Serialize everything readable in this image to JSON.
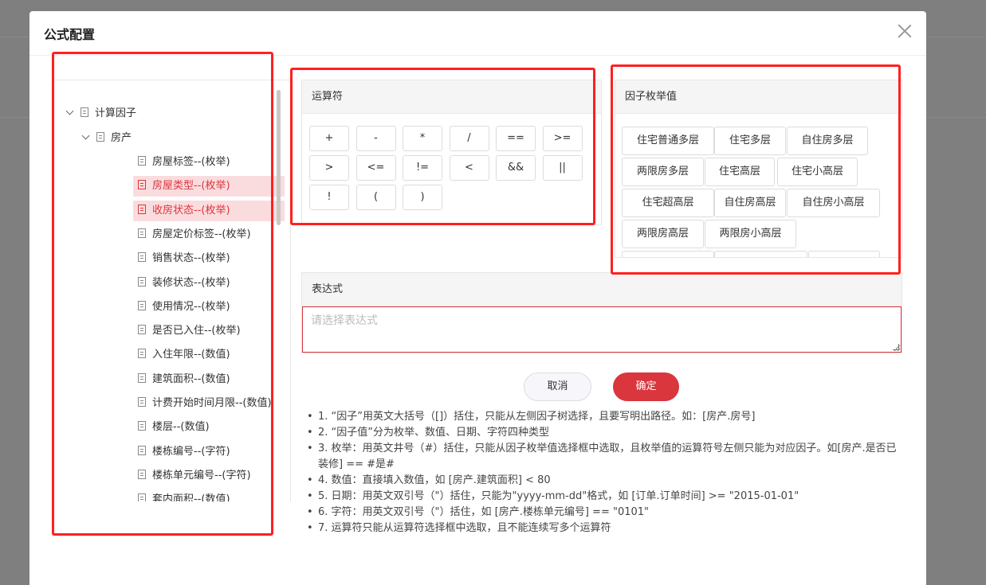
{
  "modal": {
    "title": "公式配置"
  },
  "tree": {
    "root": "计算因子",
    "group": "房产",
    "leaves": [
      {
        "label": "房屋标签--(枚举)",
        "active": false
      },
      {
        "label": "房屋类型--(枚举)",
        "active": true
      },
      {
        "label": "收房状态--(枚举)",
        "active": true
      },
      {
        "label": "房屋定价标签--(枚举)",
        "active": false
      },
      {
        "label": "销售状态--(枚举)",
        "active": false
      },
      {
        "label": "装修状态--(枚举)",
        "active": false
      },
      {
        "label": "使用情况--(枚举)",
        "active": false
      },
      {
        "label": "是否已入住--(枚举)",
        "active": false
      },
      {
        "label": "入住年限--(数值)",
        "active": false
      },
      {
        "label": "建筑面积--(数值)",
        "active": false
      },
      {
        "label": "计费开始时间月限--(数值)",
        "active": false
      },
      {
        "label": "楼层--(数值)",
        "active": false
      },
      {
        "label": "楼栋编号--(字符)",
        "active": false
      },
      {
        "label": "楼栋单元编号--(字符)",
        "active": false
      },
      {
        "label": "套内面积--(数值)",
        "active": false
      }
    ]
  },
  "operators": {
    "title": "运算符",
    "items": [
      "+",
      "-",
      "*",
      "/",
      "==",
      ">=",
      ">",
      "<=",
      "!=",
      "<",
      "&&",
      "||",
      "!",
      "(",
      ")"
    ]
  },
  "enums": {
    "title": "因子枚举值",
    "items": [
      "住宅普通多层",
      "住宅多层",
      "自住房多层",
      "两限房多层",
      "住宅高层",
      "住宅小高层",
      "住宅超高层",
      "自住房高层",
      "自住房小高层",
      "两限房高层",
      "两限房小高层"
    ]
  },
  "expression": {
    "title": "表达式",
    "placeholder": "请选择表达式"
  },
  "buttons": {
    "cancel": "取消",
    "ok": "确定"
  },
  "notes": [
    "1. “因子”用英文大括号（[]）括住，只能从左侧因子树选择，且要写明出路径。如：[房产.房号]",
    "2. “因子值”分为枚举、数值、日期、字符四种类型",
    "3. 枚举：用英文井号（#）括住，只能从因子枚举值选择框中选取，且枚举值的运算符号左侧只能为对应因子。如[房产.是否已装修] == #是#",
    "4. 数值：直接填入数值，如 [房产.建筑面积] < 80",
    "5. 日期：用英文双引号（\"）括住，只能为\"yyyy-mm-dd\"格式，如 [订单.订单时间] >= \"2015-01-01\"",
    "6. 字符：用英文双引号（\"）括住，如 [房产.楼栋单元编号] == \"0101\"",
    "7. 运算符只能从运算符选择框中选取，且不能连续写多个运算符"
  ],
  "colors": {
    "accent": "#d9363e",
    "highlight": "#ff2020"
  }
}
